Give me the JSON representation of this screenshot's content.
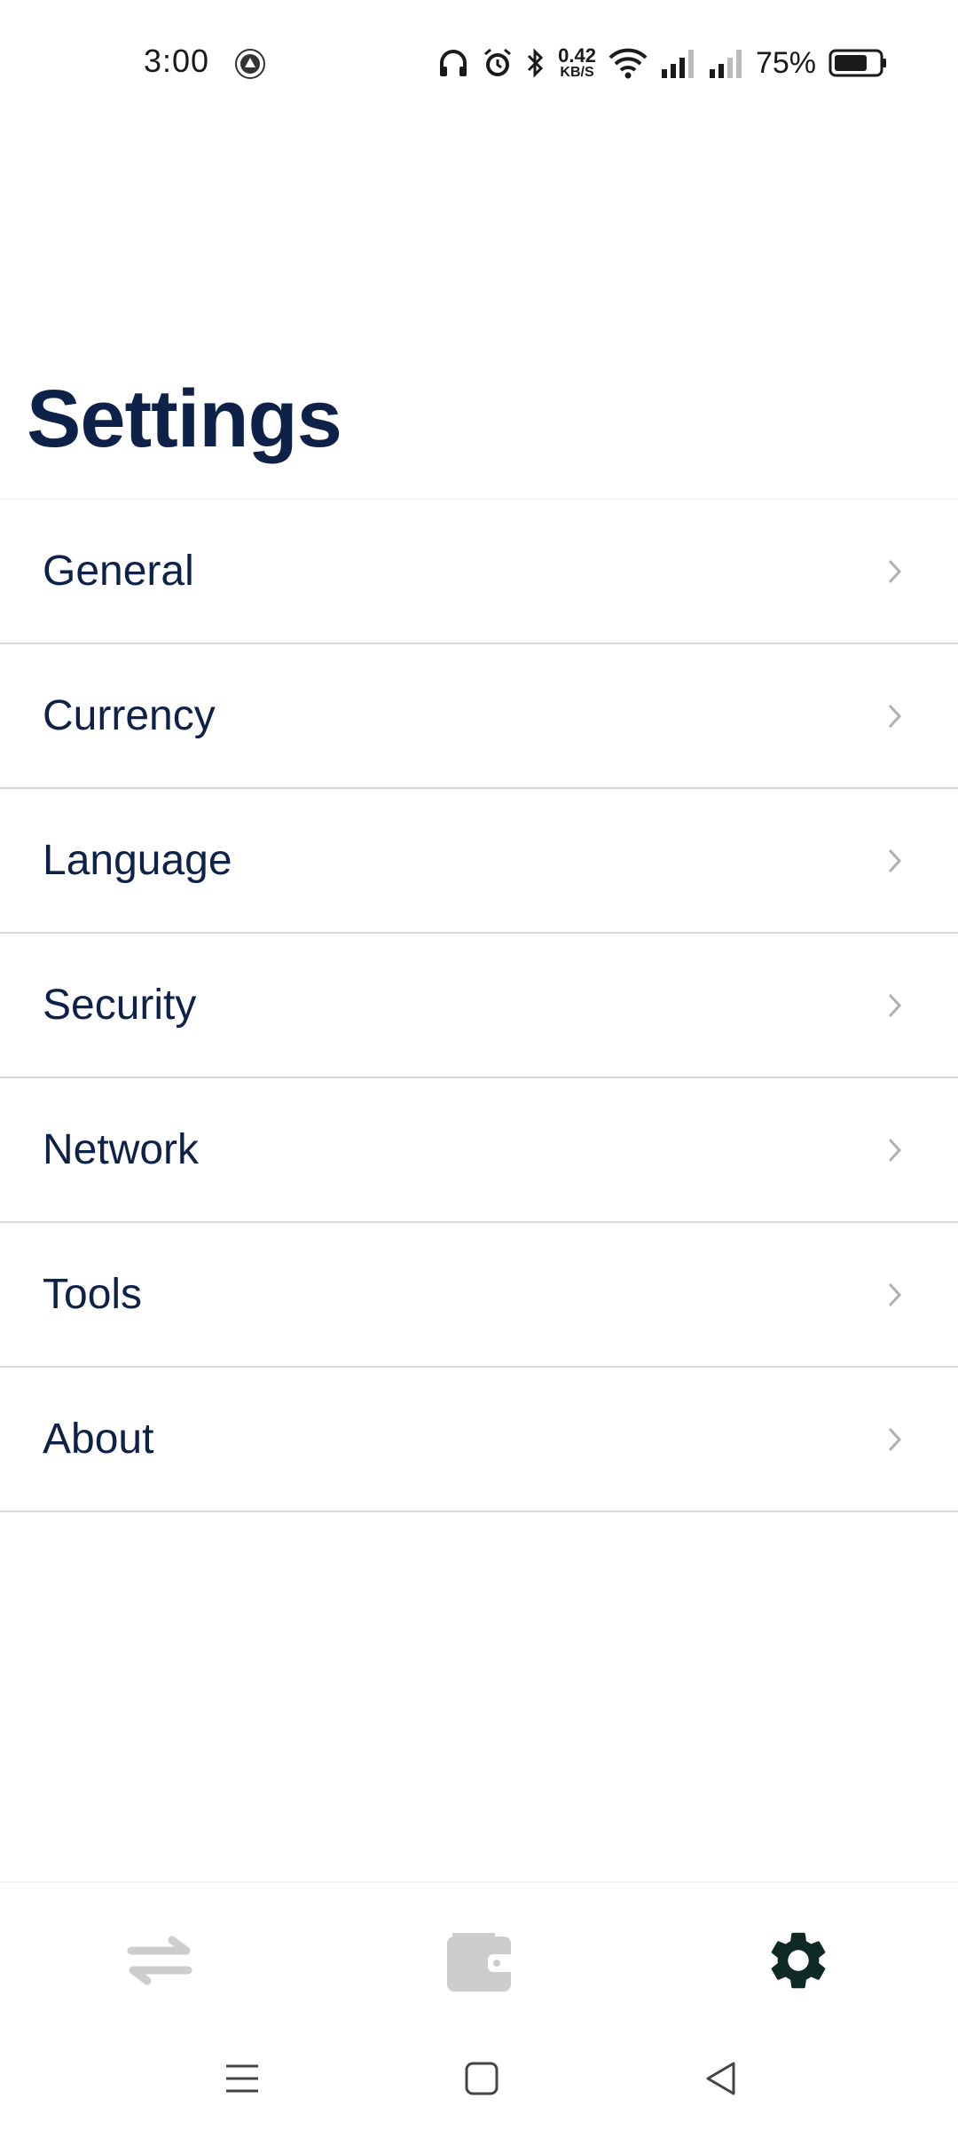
{
  "status_bar": {
    "time": "3:00",
    "net_speed_value": "0.42",
    "net_speed_unit": "KB/S",
    "battery_percent": "75%",
    "battery_level": 0.75,
    "icons": [
      "notification-badge-icon",
      "headphones-icon",
      "alarm-icon",
      "bluetooth-icon",
      "wifi-icon",
      "signal-icon",
      "signal-icon",
      "battery-icon"
    ]
  },
  "page": {
    "title": "Settings"
  },
  "settings": {
    "items": [
      {
        "label": "General"
      },
      {
        "label": "Currency"
      },
      {
        "label": "Language"
      },
      {
        "label": "Security"
      },
      {
        "label": "Network"
      },
      {
        "label": "Tools"
      },
      {
        "label": "About"
      }
    ]
  },
  "bottom_nav": {
    "items": [
      {
        "icon": "transfer-icon",
        "active": false
      },
      {
        "icon": "wallet-icon",
        "active": false
      },
      {
        "icon": "gear-icon",
        "active": true
      }
    ],
    "active_color": "#0f2a24",
    "inactive_color": "#cdcdcd"
  },
  "system_nav": {
    "icons": [
      "menu-icon",
      "home-icon",
      "back-icon"
    ]
  },
  "colors": {
    "title": "#0e2148",
    "divider": "#d9d9d9",
    "chevron": "#b0b0b0"
  }
}
